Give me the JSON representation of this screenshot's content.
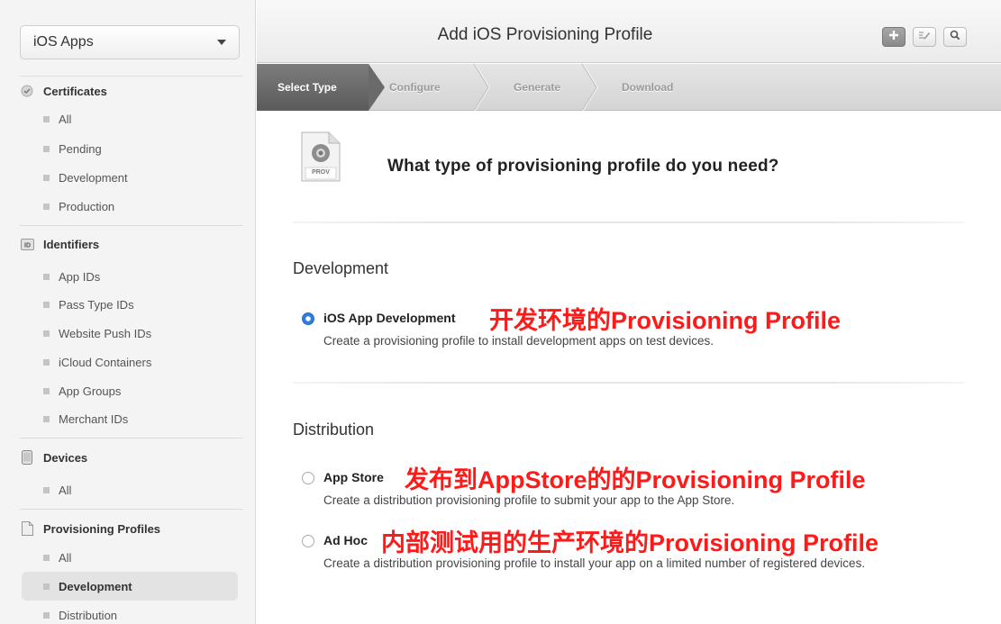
{
  "sidebar": {
    "platform": "iOS Apps",
    "sections": [
      {
        "title": "Certificates",
        "icon": "certificate-icon",
        "items": [
          "All",
          "Pending",
          "Development",
          "Production"
        ]
      },
      {
        "title": "Identifiers",
        "icon": "id-icon",
        "items": [
          "App IDs",
          "Pass Type IDs",
          "Website Push IDs",
          "iCloud Containers",
          "App Groups",
          "Merchant IDs"
        ]
      },
      {
        "title": "Devices",
        "icon": "device-icon",
        "items": [
          "All"
        ]
      },
      {
        "title": "Provisioning Profiles",
        "icon": "document-icon",
        "items": [
          "All",
          "Development",
          "Distribution"
        ],
        "active": "Development"
      }
    ]
  },
  "header": {
    "title": "Add iOS Provisioning Profile",
    "buttons": [
      "plus-icon",
      "edit-icon",
      "search-icon"
    ]
  },
  "steps": [
    "Select Type",
    "Configure",
    "Generate",
    "Download"
  ],
  "main": {
    "icon_label": "PROV",
    "question": "What type of provisioning profile do you need?",
    "groups": [
      {
        "title": "Development",
        "options": [
          {
            "label": "iOS App Development",
            "annotation": "开发环境的Provisioning Profile",
            "description": "Create a provisioning profile to install development apps on test devices.",
            "checked": true
          }
        ]
      },
      {
        "title": "Distribution",
        "options": [
          {
            "label": "App Store",
            "annotation": "发布到AppStore的的Provisioning Profile",
            "description": "Create a distribution provisioning profile to submit your app to the App Store.",
            "checked": false
          },
          {
            "label": "Ad Hoc",
            "annotation": "内部测试用的生产环境的Provisioning Profile",
            "description": "Create a distribution provisioning profile to install your app on a limited number of registered devices.",
            "checked": false
          }
        ]
      }
    ]
  },
  "colors": {
    "annotation": "#ff1a1a",
    "radio_selected": "#2f7de1",
    "step_active": "#6a6a6a"
  }
}
